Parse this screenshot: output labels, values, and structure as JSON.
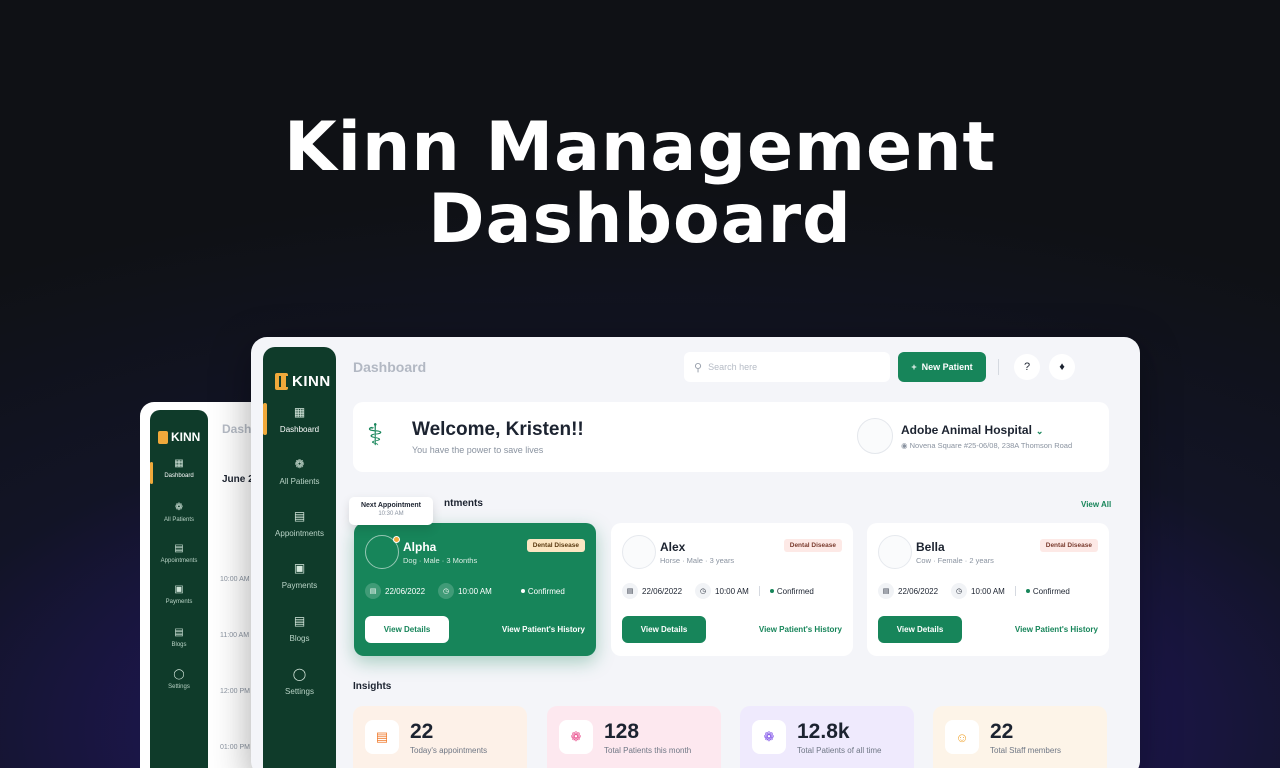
{
  "hero": {
    "line1": "Kinn Management",
    "line2": "Dashboard"
  },
  "back_window": {
    "logo": "KINN",
    "title": "Dashb",
    "date": "June 20",
    "nav": [
      "Dashboard",
      "All Patients",
      "Appointments",
      "Payments",
      "Blogs",
      "Settings"
    ],
    "times": [
      "10:00 AM",
      "11:00 AM",
      "12:00 PM",
      "01:00 PM"
    ]
  },
  "sidebar": {
    "logo": "KINN",
    "items": [
      {
        "label": "Dashboard",
        "icon": "grid-icon"
      },
      {
        "label": "All Patients",
        "icon": "paw-icon"
      },
      {
        "label": "Appointments",
        "icon": "calendar-icon"
      },
      {
        "label": "Payments",
        "icon": "wallet-icon"
      },
      {
        "label": "Blogs",
        "icon": "blog-icon"
      },
      {
        "label": "Settings",
        "icon": "user-icon"
      }
    ]
  },
  "header": {
    "title": "Dashboard",
    "search_placeholder": "Search here",
    "new_patient_label": "New Patient"
  },
  "welcome": {
    "title": "Welcome, Kristen!!",
    "subtitle": "You have the power to save lives",
    "hospital_name": "Adobe Animal Hospital",
    "hospital_address": "Novena Square #25-06/08, 238A Thomson Road"
  },
  "appointments": {
    "section_title": "ntments",
    "view_all": "View All",
    "tooltip_title": "Next Appointment",
    "tooltip_time": "10:30 AM",
    "cards": [
      {
        "name": "Alpha",
        "meta": "Dog · Male · 3 Months",
        "badge": "Dental Disease",
        "date": "22/06/2022",
        "time": "10:00 AM",
        "status": "Confirmed",
        "details_label": "View Details",
        "history_label": "View Patient's History"
      },
      {
        "name": "Alex",
        "meta": "Horse · Male · 3 years",
        "badge": "Dental Disease",
        "date": "22/06/2022",
        "time": "10:00 AM",
        "status": "Confirmed",
        "details_label": "View Details",
        "history_label": "View Patient's History"
      },
      {
        "name": "Bella",
        "meta": "Cow · Female · 2 years",
        "badge": "Dental Disease",
        "date": "22/06/2022",
        "time": "10:00 AM",
        "status": "Confirmed",
        "details_label": "View Details",
        "history_label": "View Patient's History"
      }
    ]
  },
  "insights": {
    "section_title": "Insights",
    "cards": [
      {
        "value": "22",
        "label": "Today's appointments",
        "icon": "calendar-icon",
        "bg": "#fdf1e8",
        "icon_color": "#f07a2c"
      },
      {
        "value": "128",
        "label": "Total Patients this month",
        "icon": "paw-icon",
        "bg": "#fde8ef",
        "icon_color": "#e84a8a"
      },
      {
        "value": "12.8k",
        "label": "Total Patients of all time",
        "icon": "paw-icon",
        "bg": "#efeafd",
        "icon_color": "#7a4be8"
      },
      {
        "value": "22",
        "label": "Total Staff members",
        "icon": "team-icon",
        "bg": "#fdf4e8",
        "icon_color": "#f0a93b"
      }
    ]
  },
  "colors": {
    "brand": "#17855a",
    "sidebar": "#0f3b2a",
    "accent": "#f0a93b"
  }
}
